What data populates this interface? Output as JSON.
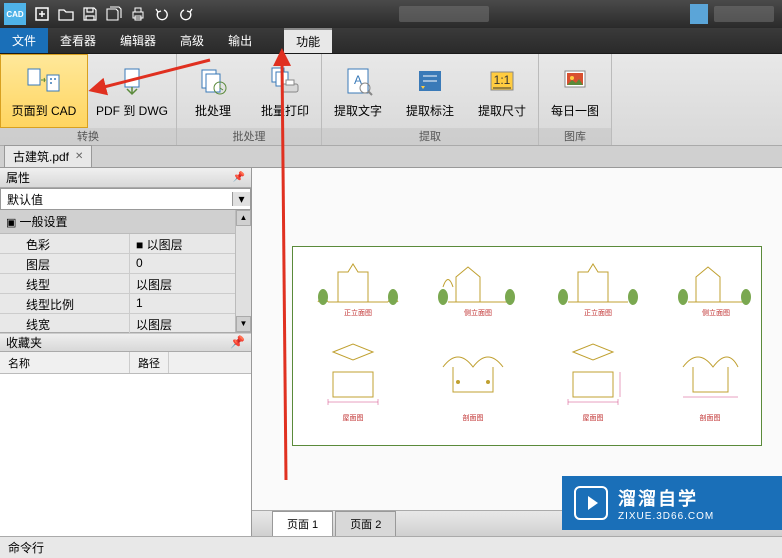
{
  "app_icon_label": "CAD",
  "menu": {
    "file": "文件",
    "viewer": "查看器",
    "editor": "编辑器",
    "advanced": "高级",
    "output": "输出",
    "function": "功能"
  },
  "ribbon": {
    "page_to_cad": "页面到 CAD",
    "pdf_to_dwg": "PDF 到 DWG",
    "batch_process": "批处理",
    "batch_print": "批量打印",
    "extract_text": "提取文字",
    "extract_annotation": "提取标注",
    "extract_dimension": "提取尺寸",
    "daily_image": "每日一图",
    "group_convert": "转换",
    "group_batch": "批处理",
    "group_extract": "提取",
    "group_gallery": "图库"
  },
  "file_tab": {
    "name": "古建筑.pdf"
  },
  "panels": {
    "properties": "属性",
    "default_value": "默认值",
    "general_settings": "一般设置",
    "favorites": "收藏夹",
    "col_name": "名称",
    "col_path": "路径"
  },
  "props": [
    {
      "k": "色彩",
      "v": "■ 以图层"
    },
    {
      "k": "图层",
      "v": "0"
    },
    {
      "k": "线型",
      "v": "以图层"
    },
    {
      "k": "线型比例",
      "v": "1"
    },
    {
      "k": "线宽",
      "v": "以图层"
    }
  ],
  "page_tabs": {
    "p1": "页面 1",
    "p2": "页面 2"
  },
  "cmd": {
    "label": "命令行"
  },
  "watermark": {
    "title": "溜溜自学",
    "url": "ZIXUE.3D66.COM"
  }
}
